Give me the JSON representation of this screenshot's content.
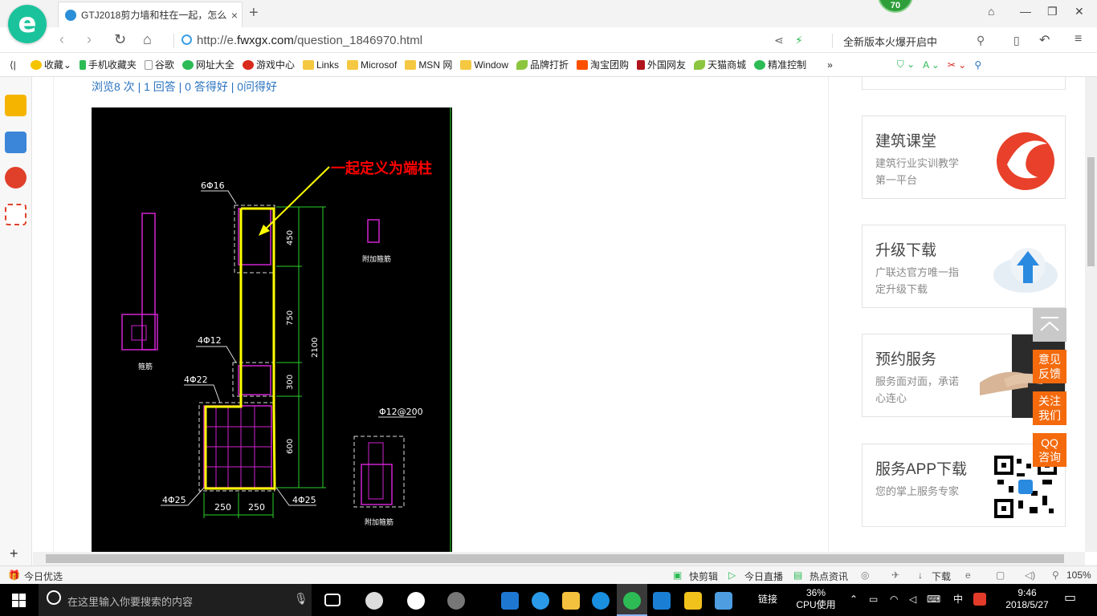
{
  "browser": {
    "tab_title": "GTJ2018剪力墙和柱在一起，怎么...",
    "new_tab_symbol": "+",
    "close_symbol": "×",
    "notification_count": "70",
    "url_prefix": "http://e.",
    "url_domain": "fwxgx.com",
    "url_path": "/question_1846970.html",
    "promo_text": "全新版本火爆开启中"
  },
  "bookmarks": [
    {
      "label": "收藏",
      "icon": "star-icon"
    },
    {
      "label": "手机收藏夹",
      "icon": "phone-icon"
    },
    {
      "label": "谷歌",
      "icon": "page-icon"
    },
    {
      "label": "网址大全",
      "icon": "globe-icon"
    },
    {
      "label": "游戏中心",
      "icon": "game-icon"
    },
    {
      "label": "Links",
      "icon": "folder-icon"
    },
    {
      "label": "Microsof",
      "icon": "folder-icon"
    },
    {
      "label": "MSN 网",
      "icon": "folder-icon"
    },
    {
      "label": "Window",
      "icon": "folder-icon"
    },
    {
      "label": "品牌打折",
      "icon": "leaf-icon"
    },
    {
      "label": "淘宝团购",
      "icon": "taobao-icon"
    },
    {
      "label": "外国网友",
      "icon": "flag-icon"
    },
    {
      "label": "天猫商城",
      "icon": "leaf-icon"
    },
    {
      "label": "精准控制",
      "icon": "wechat-icon"
    }
  ],
  "question": {
    "stats": "浏览8 次 | 1 回答 | 0 答得好 | 0问得好"
  },
  "cad_drawing": {
    "callout": "一起定义为端柱",
    "labels": {
      "rebar_top": "6Φ16",
      "rebar_mid": "4Φ12",
      "rebar_22": "4Φ22",
      "rebar_left": "4Φ25",
      "rebar_right": "4Φ25",
      "stirrup": "Φ12@200",
      "dim_450": "450",
      "dim_750": "750",
      "dim_300": "300",
      "dim_600": "600",
      "dim_total": "2100",
      "dim_w1": "250",
      "dim_w2": "250",
      "note_left": "箍筋",
      "note_top_right": "附加箍筋",
      "note_bottom_right": "附加箍筋"
    }
  },
  "sidebar_cards": [
    {
      "title": "建筑课堂",
      "subtitle": "建筑行业实训教学第一平台"
    },
    {
      "title": "升级下载",
      "subtitle": "广联达官方唯一指定升级下载"
    },
    {
      "title": "预约服务",
      "subtitle": "服务面对面，承诺心连心"
    },
    {
      "title": "服务APP下载",
      "subtitle": "您的掌上服务专家"
    }
  ],
  "float_buttons": [
    {
      "line1": "意见",
      "line2": "反馈"
    },
    {
      "line1": "关注",
      "line2": "我们"
    },
    {
      "line1": "QQ",
      "line2": "咨询"
    }
  ],
  "statusbar": {
    "today": "今日优选",
    "kuaijianji": "快剪辑",
    "live": "今日直播",
    "news": "热点资讯",
    "download": "下载",
    "zoom": "105%"
  },
  "taskbar": {
    "search_placeholder": "在这里输入你要搜索的内容",
    "link_label": "链接",
    "cpu_percent": "36%",
    "cpu_label": "CPU使用",
    "ime": "中",
    "time": "9:46",
    "date": "2018/5/27"
  }
}
